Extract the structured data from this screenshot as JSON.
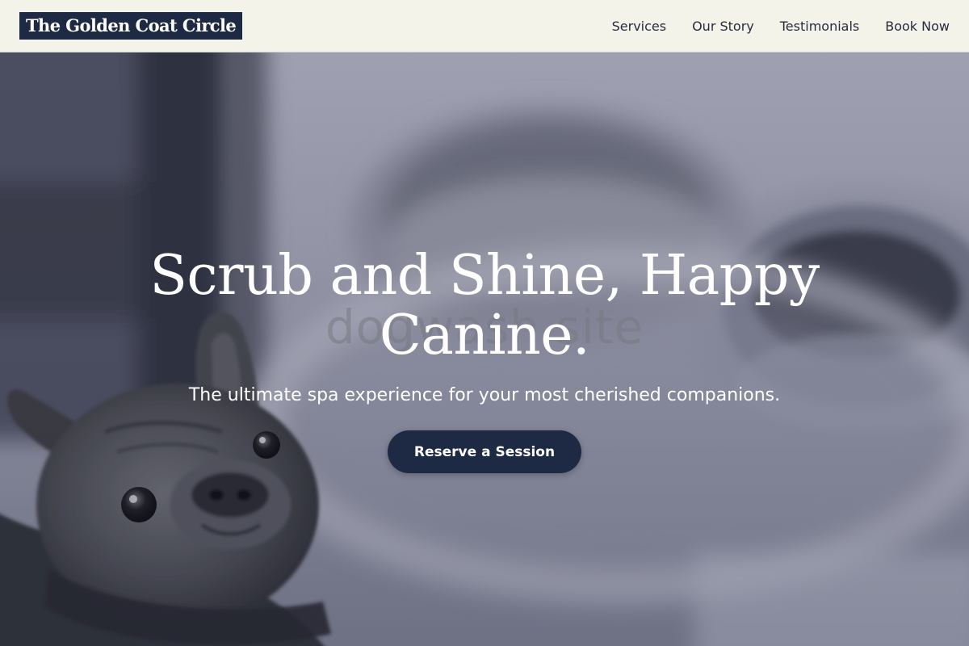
{
  "header": {
    "logo_text": "The Golden Coat Circle",
    "nav": [
      {
        "label": "Services"
      },
      {
        "label": "Our Story"
      },
      {
        "label": "Testimonials"
      },
      {
        "label": "Book Now"
      }
    ]
  },
  "hero": {
    "watermark": "dogwash site",
    "headline_line1": "Scrub and Shine, Happy",
    "headline_line2": "Canine.",
    "subheadline": "The ultimate spa experience for your most cherished companions.",
    "cta_label": "Reserve a Session",
    "background_image": "french-bulldog-cafe-photo"
  },
  "colors": {
    "brand_navy": "#1e2a44",
    "header_background": "#f4f3e9",
    "nav_text": "#262c3c",
    "hero_text": "#ffffff"
  }
}
